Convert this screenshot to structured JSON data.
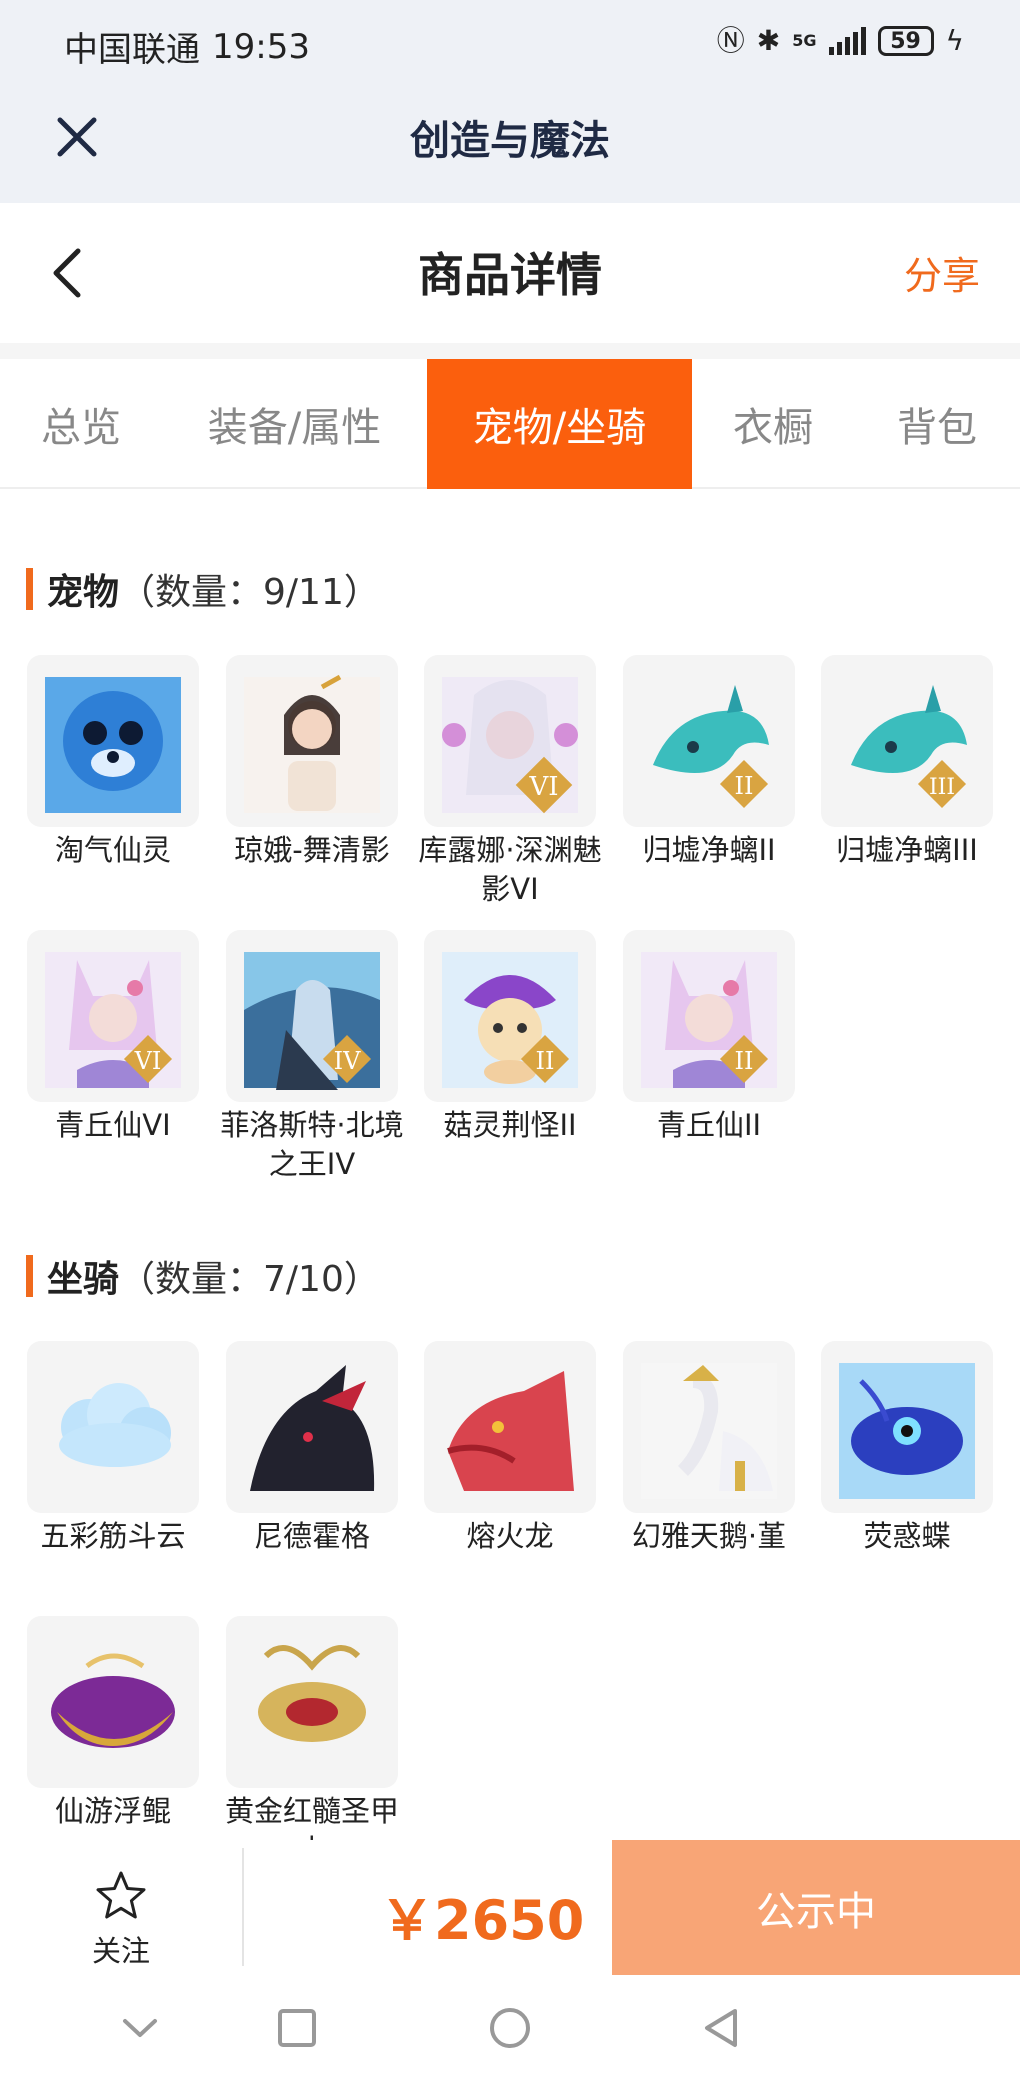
{
  "status_bar": {
    "carrier": "中国联通",
    "time": "19:53",
    "network": "5G",
    "battery": "59"
  },
  "app": {
    "title": "创造与魔法"
  },
  "header": {
    "title": "商品详情",
    "share_label": "分享"
  },
  "tabs": [
    {
      "label": "总览",
      "active": false
    },
    {
      "label": "装备/属性",
      "active": false
    },
    {
      "label": "宠物/坐骑",
      "active": true
    },
    {
      "label": "衣橱",
      "active": false
    },
    {
      "label": "背包",
      "active": false
    }
  ],
  "pets": {
    "name": "宠物",
    "count": "（数量：9/11）",
    "items": [
      {
        "name": "淘气仙灵",
        "icon": "blue-seal-pet"
      },
      {
        "name": "琼娥-舞清影",
        "icon": "fairy-girl-pet"
      },
      {
        "name": "库露娜·深渊魅影VI",
        "icon": "white-hair-girl-pet"
      },
      {
        "name": "归墟净螭II",
        "icon": "teal-dragon-pet"
      },
      {
        "name": "归墟净螭III",
        "icon": "teal-dragon-pet"
      },
      {
        "name": "青丘仙VI",
        "icon": "fox-fairy-pet"
      },
      {
        "name": "菲洛斯特·北境之王IV",
        "icon": "ice-king-pet"
      },
      {
        "name": "菇灵荆怪II",
        "icon": "purple-mushroom-pet"
      },
      {
        "name": "青丘仙II",
        "icon": "fox-fairy-pet"
      }
    ]
  },
  "mounts": {
    "name": "坐骑",
    "count": "（数量：7/10）",
    "items": [
      {
        "name": "五彩筋斗云",
        "icon": "cloud-mount"
      },
      {
        "name": "尼德霍格",
        "icon": "black-dragon-mount"
      },
      {
        "name": "熔火龙",
        "icon": "red-dragon-mount"
      },
      {
        "name": "幻雅天鹅·堇",
        "icon": "swan-mount"
      },
      {
        "name": "荧惑蝶",
        "icon": "blue-butterfly-mount"
      },
      {
        "name": "仙游浮鲲",
        "icon": "flying-whale-mount"
      },
      {
        "name": "黄金红髓圣甲虫",
        "icon": "golden-beetle-mount"
      }
    ]
  },
  "bottom_bar": {
    "follow_label": "关注",
    "price": "￥2650",
    "status_label": "公示中"
  },
  "colors": {
    "accent": "#f06a1d",
    "active_tab": "#fb5f0d",
    "status_button": "#f8a576"
  }
}
